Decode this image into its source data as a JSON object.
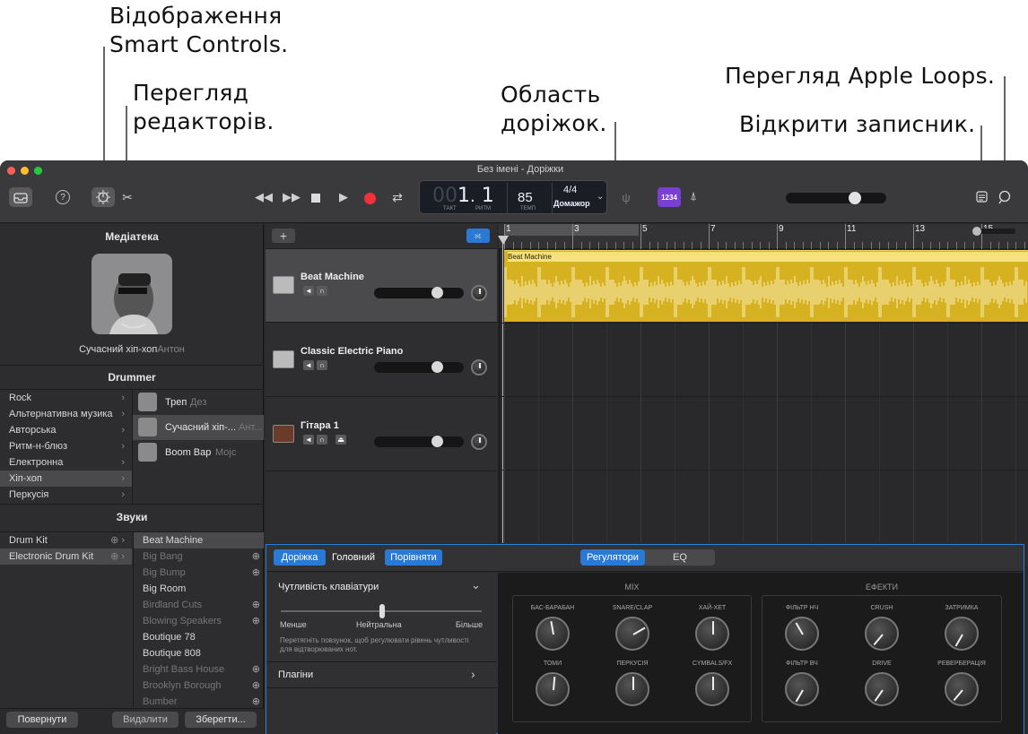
{
  "callouts": {
    "smart_controls": "Відображення\nSmart Controls.",
    "editors": "Перегляд\nредакторів.",
    "tracks_area": "Область\nдоріжок.",
    "apple_loops": "Перегляд Apple Loops.",
    "notepad": "Відкрити записник."
  },
  "window": {
    "title": "Без імені - Доріжки"
  },
  "lcd": {
    "bar": "1",
    "beat": "1",
    "bar_prefix": "00",
    "bar_label": "ТАКТ",
    "beat_label": "РИТМ",
    "tempo": "85",
    "tempo_label": "ТЕМП",
    "signature": "4/4",
    "key": "Домажор",
    "count_in": "1234"
  },
  "library": {
    "title": "Медіатека",
    "patch_name": "Сучасний хіп-хоп",
    "patch_author": "Антон",
    "drummer_title": "Drummer",
    "genres": [
      "Rock",
      "Альтернативна музика",
      "Авторська",
      "Ритм-н-блюз",
      "Електронна",
      "Хіп-хоп",
      "Перкусія"
    ],
    "selected_genre": 5,
    "drummers": [
      {
        "name": "Треп",
        "author": "Дез"
      },
      {
        "name": "Сучасний хіп-...",
        "author": "Ант..."
      },
      {
        "name": "Boom Bap",
        "author": "Мојс"
      }
    ],
    "sounds_title": "Звуки",
    "sound_categories": [
      "Drum Kit",
      "Electronic Drum Kit"
    ],
    "sounds": [
      {
        "name": "Beat Machine",
        "state": "selected"
      },
      {
        "name": "Big Bang",
        "state": "download"
      },
      {
        "name": "Big Bump",
        "state": "download"
      },
      {
        "name": "Big Room",
        "state": "available"
      },
      {
        "name": "Birdland Cuts",
        "state": "download"
      },
      {
        "name": "Blowing Speakers",
        "state": "download"
      },
      {
        "name": "Boutique 78",
        "state": "available"
      },
      {
        "name": "Boutique 808",
        "state": "available"
      },
      {
        "name": "Bright Bass House",
        "state": "download"
      },
      {
        "name": "Brooklyn Borough",
        "state": "download"
      },
      {
        "name": "Bumber",
        "state": "download"
      }
    ],
    "revert_label": "Повернути",
    "delete_label": "Видалити",
    "save_label": "Зберегти..."
  },
  "tracks": [
    {
      "name": "Beat Machine",
      "volume": 0.72
    },
    {
      "name": "Classic Electric Piano",
      "volume": 0.72
    },
    {
      "name": "Гітара 1",
      "volume": 0.72
    }
  ],
  "ruler": [
    "1",
    "3",
    "5",
    "7",
    "9",
    "11",
    "13",
    "15"
  ],
  "region": {
    "name": "Beat Machine",
    "color": "#e8c226"
  },
  "smart_controls": {
    "tabs": [
      "Доріжка",
      "Головний",
      "Порівняти"
    ],
    "view_tabs": [
      "Регулятори",
      "EQ"
    ],
    "velocity_title": "Чутливість клавіатури",
    "velocity_less": "Менше",
    "velocity_neutral": "Нейтральна",
    "velocity_more": "Більше",
    "velocity_hint": "Перетягніть повзунок, щоб регулювати рівень чутливості для відтворюваних нот.",
    "plugins_label": "Плагіни",
    "mix_title": "MIX",
    "fx_title": "ЕФЕКТИ",
    "mix_knobs": [
      "БАС-БАРАБАН",
      "SNARE/CLAP",
      "ХАЙ-ХЕТ",
      "ТОМИ",
      "ПЕРКУСІЯ",
      "CYMBALS/FX"
    ],
    "fx_knobs": [
      "ФІЛЬТР НЧ",
      "CRUSH",
      "ЗАТРИМКА",
      "ФІЛЬТР ВЧ",
      "DRIVE",
      "РЕВЕРБЕРАЦІЯ"
    ]
  }
}
